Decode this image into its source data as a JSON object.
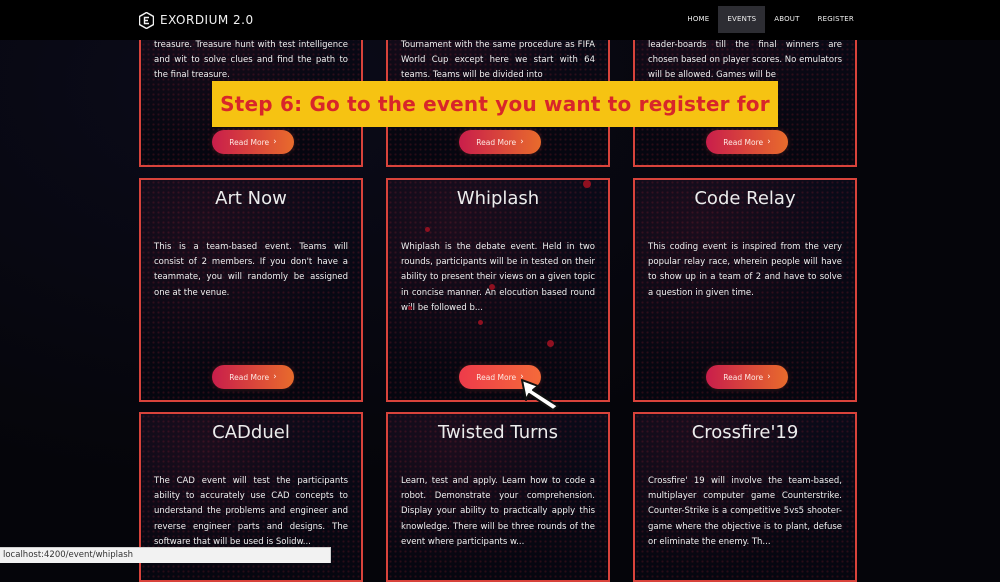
{
  "brand": {
    "name": "EXORDIUM 2.0"
  },
  "nav": {
    "items": [
      "HOME",
      "EVENTS",
      "ABOUT",
      "REGISTER"
    ],
    "active": "EVENTS"
  },
  "banner": {
    "text": "Step 6: Go to the event you want to register for"
  },
  "events": [
    {
      "title": "",
      "description": "treasure. Treasure hunt with test intelligence and wit to solve clues and find the path to the final treasure.",
      "button": "Read More"
    },
    {
      "title": "",
      "description": "Tournament with the same procedure as FIFA World Cup except here we start with 64 teams. Teams will be divided into",
      "button": "Read More"
    },
    {
      "title": "",
      "description": "leader-boards till the final winners are chosen based on player scores. No emulators will be allowed. Games will be",
      "button": "Read More"
    },
    {
      "title": "Art Now",
      "description": "This is a team-based event. Teams will consist of 2 members. If you don't have a teammate, you will randomly be assigned one at the venue.",
      "button": "Read More"
    },
    {
      "title": "Whiplash",
      "description": "Whiplash is the debate event. Held in two rounds, participants will be in tested on their ability to present their views on a given topic in concise manner. An elocution based round will be followed b...",
      "button": "Read More"
    },
    {
      "title": "Code Relay",
      "description": "This coding event is inspired from the very popular relay race, wherein people will have to show up in a team of 2 and have to solve a question in given time.",
      "button": "Read More"
    },
    {
      "title": "CADduel",
      "description": "The CAD event will test the participants ability to accurately use CAD concepts to understand the problems and engineer and reverse engineer parts and designs. The software that will be used is Solidw...",
      "button": "Read More"
    },
    {
      "title": "Twisted Turns",
      "description": "Learn, test and apply. Learn how to code a robot. Demonstrate your comprehension. Display your ability to practically apply this knowledge. There will be three rounds of the event where participants w...",
      "button": "Read More"
    },
    {
      "title": "Crossfire'19",
      "description": "Crossfire' 19 will involve the team-based, multiplayer computer game Counterstrike. Counter-Strike is a competitive 5vs5 shooter-game where the objective is to plant, defuse or eliminate the enemy. Th...",
      "button": "Read More"
    }
  ],
  "status_bar": {
    "url": "localhost:4200/event/whiplash"
  },
  "colors": {
    "accent_border": "#d8433b",
    "banner_bg": "#f6c312",
    "banner_text": "#d8262a"
  }
}
